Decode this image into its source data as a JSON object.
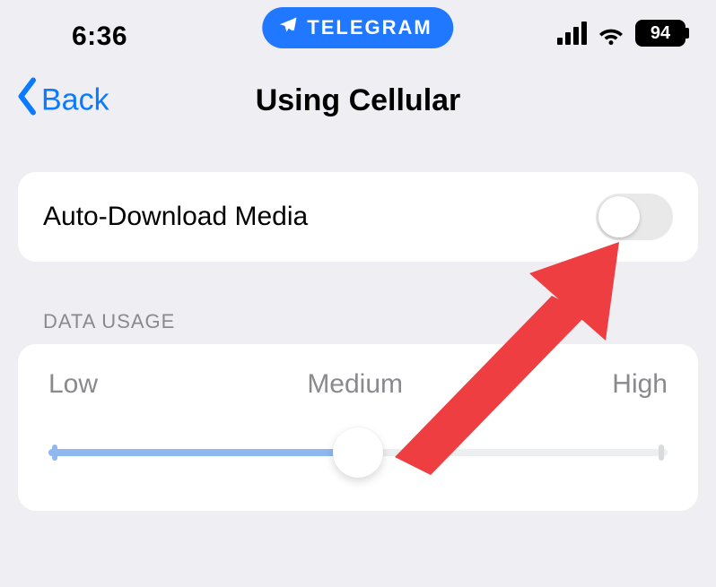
{
  "statusbar": {
    "time": "6:36",
    "app_pill": "TELEGRAM",
    "battery_pct": "94"
  },
  "nav": {
    "back_label": "Back",
    "title": "Using Cellular"
  },
  "settings": {
    "auto_download_label": "Auto-Download Media",
    "auto_download_on": false
  },
  "data_usage": {
    "section_title": "DATA USAGE",
    "low_label": "Low",
    "medium_label": "Medium",
    "high_label": "High",
    "value": "Medium"
  },
  "colors": {
    "accent": "#0a7aff",
    "pill": "#1f78ff",
    "arrow": "#ee3e41"
  }
}
